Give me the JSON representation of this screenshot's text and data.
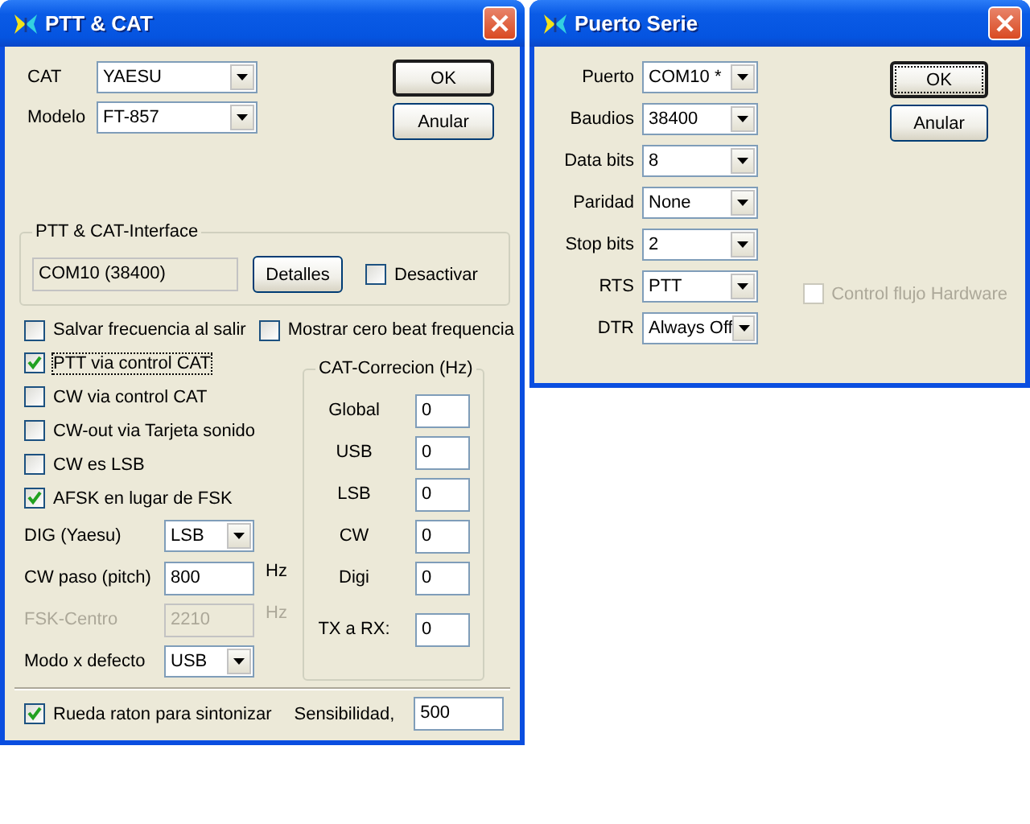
{
  "ptt_cat": {
    "title": "PTT & CAT",
    "selects": [
      {
        "label": "CAT",
        "value": "YAESU"
      },
      {
        "label": "Modelo",
        "value": "FT-857"
      }
    ],
    "buttons": [
      "OK",
      "Anular"
    ],
    "interface": {
      "legend": "PTT & CAT-Interface",
      "port": "COM10 (38400)",
      "details_button": "Detalles",
      "disable": {
        "label": "Desactivar",
        "checked": false
      }
    },
    "options": [
      {
        "label": "Salvar frecuencia al salir",
        "checked": false
      },
      {
        "label": "Mostrar cero beat frequencia",
        "checked": false
      },
      {
        "label": "PTT via control CAT",
        "checked": true
      },
      {
        "label": "CW via control CAT",
        "checked": false
      },
      {
        "label": "CW-out via Tarjeta sonido",
        "checked": false
      },
      {
        "label": "CW es LSB",
        "checked": false
      },
      {
        "label": "AFSK en lugar de FSK",
        "checked": true
      }
    ],
    "fields": [
      {
        "kind": "select",
        "label": "DIG (Yaesu)",
        "value": "LSB",
        "disabled": false
      },
      {
        "kind": "input",
        "label": "CW paso (pitch)",
        "value": "800",
        "unit": "Hz",
        "disabled": false
      },
      {
        "kind": "input",
        "label": "FSK-Centro",
        "value": "2210",
        "unit": "Hz",
        "disabled": true
      },
      {
        "kind": "select",
        "label": "Modo x defecto",
        "value": "USB",
        "disabled": false
      }
    ],
    "correction": {
      "legend": "CAT-Correcion (Hz)",
      "rows": [
        {
          "label": "Global",
          "value": "0"
        },
        {
          "label": "USB",
          "value": "0"
        },
        {
          "label": "LSB",
          "value": "0"
        },
        {
          "label": "CW",
          "value": "0"
        },
        {
          "label": "Digi",
          "value": "0"
        },
        {
          "label": "TX a RX:",
          "value": "0"
        }
      ]
    },
    "footer": {
      "wheel": {
        "label": "Rueda raton para sintonizar",
        "checked": true
      },
      "sensitivity_label": "Sensibilidad,",
      "sensitivity_value": "500"
    }
  },
  "puerto_serie": {
    "title": "Puerto Serie",
    "fields": [
      {
        "label": "Puerto",
        "value": "COM10 *"
      },
      {
        "label": "Baudios",
        "value": "38400"
      },
      {
        "label": "Data bits",
        "value": "8"
      },
      {
        "label": "Paridad",
        "value": "None"
      },
      {
        "label": "Stop bits",
        "value": "2"
      },
      {
        "label": "RTS",
        "value": "PTT"
      },
      {
        "label": "DTR",
        "value": "Always Off"
      }
    ],
    "buttons": [
      "OK",
      "Anular"
    ],
    "flow_control": {
      "label": "Control flujo Hardware",
      "checked": false,
      "disabled": true
    }
  }
}
